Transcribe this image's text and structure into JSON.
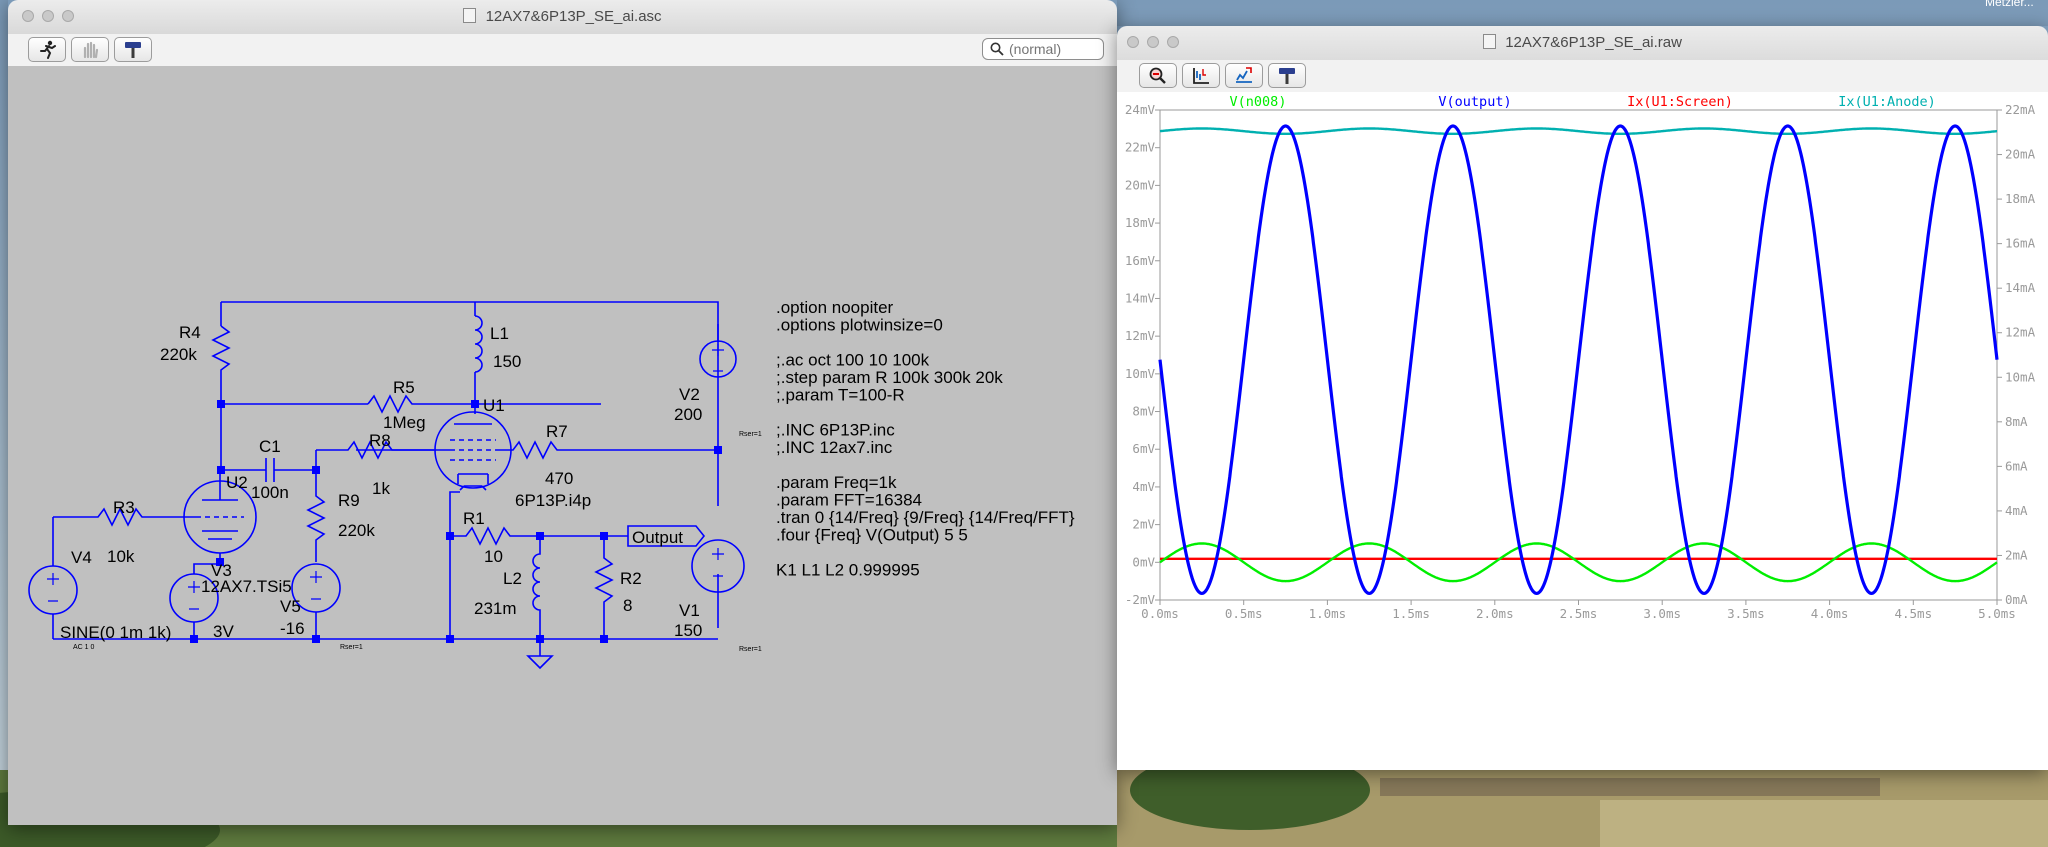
{
  "schematic_window": {
    "title": "12AX7&6P13P_SE_ai.asc",
    "search_placeholder": "(normal)",
    "toolbar": [
      {
        "name": "run-icon"
      },
      {
        "name": "halt-icon"
      },
      {
        "name": "hammer-icon"
      }
    ],
    "components": {
      "R4": {
        "ref": "R4",
        "value": "220k"
      },
      "L1": {
        "ref": "L1",
        "value": "150"
      },
      "R5": {
        "ref": "R5",
        "value": "1Meg"
      },
      "U1": {
        "ref": "U1",
        "model": "6P13P.i4p"
      },
      "C1": {
        "ref": "C1",
        "value": "100n"
      },
      "R8": {
        "ref": "R8",
        "value": "1k"
      },
      "R7": {
        "ref": "R7",
        "value": "470"
      },
      "U2": {
        "ref": "U2",
        "model": "12AX7.TSi5"
      },
      "R3": {
        "ref": "R3",
        "value": "10k"
      },
      "R9": {
        "ref": "R9",
        "value": "220k"
      },
      "R1": {
        "ref": "R1",
        "value": "10"
      },
      "L2": {
        "ref": "L2",
        "value": "231m"
      },
      "R2": {
        "ref": "R2",
        "value": "8"
      },
      "V2": {
        "ref": "V2",
        "value": "200"
      },
      "V1": {
        "ref": "V1",
        "value": "150"
      },
      "V3": {
        "ref": "V3",
        "value": "3V"
      },
      "V4": {
        "ref": "V4",
        "value": "SINE(0 1m 1k)",
        "ac": "AC 1 0"
      },
      "V5": {
        "ref": "V5",
        "value": "-16"
      }
    },
    "rser_labels": [
      "Rser=1",
      "Rser=1",
      "Rser=1"
    ],
    "net_label": "Output",
    "directives": [
      ".option noopiter",
      ".options plotwinsize=0",
      "",
      ";.ac oct 100 10 100k",
      ";.step param R 100k 300k 20k",
      ";.param T=100-R",
      "",
      ";.INC 6P13P.inc",
      ";.INC 12ax7.inc",
      "",
      ".param Freq=1k",
      ".param FFT=16384",
      ".tran 0 {14/Freq} {9/Freq} {14/Freq/FFT}",
      ".four {Freq} V(Output) 5 5",
      "",
      "K1 L1 L2 0.999995"
    ]
  },
  "plot_window": {
    "title": "12AX7&6P13P_SE_ai.raw",
    "toolbar": [
      {
        "name": "zoom-icon"
      },
      {
        "name": "autorange-icon"
      },
      {
        "name": "export-icon"
      },
      {
        "name": "hammer-icon"
      }
    ]
  },
  "desktop": {
    "corner_text": "Metzler..."
  },
  "chart_data": {
    "type": "line",
    "xlabel": "",
    "xlim": [
      0,
      5
    ],
    "x_unit": "ms",
    "x_ticks": [
      "0.0ms",
      "0.5ms",
      "1.0ms",
      "1.5ms",
      "2.0ms",
      "2.5ms",
      "3.0ms",
      "3.5ms",
      "4.0ms",
      "4.5ms",
      "5.0ms"
    ],
    "ylim_left": [
      -2,
      24
    ],
    "y_ticks_left": [
      "-2mV",
      "0mV",
      "2mV",
      "4mV",
      "6mV",
      "8mV",
      "10mV",
      "12mV",
      "14mV",
      "16mV",
      "18mV",
      "20mV",
      "22mV",
      "24mV"
    ],
    "ylim_right": [
      0,
      22
    ],
    "y_ticks_right": [
      "0mA",
      "2mA",
      "4mA",
      "6mA",
      "8mA",
      "10mA",
      "12mA",
      "14mA",
      "16mA",
      "18mA",
      "20mA",
      "22mA"
    ],
    "series": [
      {
        "name": "V(n008)",
        "color": "#00ee00",
        "axis": "left",
        "shape": "sine",
        "offset": 0,
        "amplitude": 1.0,
        "freq_khz": 1,
        "peak_at_ms": 0.25
      },
      {
        "name": "V(output)",
        "color": "#0000ff",
        "axis": "left",
        "shape": "sine",
        "offset": 10.75,
        "amplitude": 12.4,
        "freq_khz": 1,
        "peak_at_ms": 0.75
      },
      {
        "name": "Ix(U1:Screen)",
        "color": "#ff0000",
        "axis": "right",
        "shape": "flat",
        "offset": 1.85,
        "amplitude": 0,
        "freq_khz": 1,
        "peak_at_ms": 0
      },
      {
        "name": "Ix(U1:Anode)",
        "color": "#00b0b0",
        "axis": "right",
        "shape": "sine",
        "offset": 21.05,
        "amplitude": 0.12,
        "freq_khz": 1,
        "peak_at_ms": 0.25
      }
    ]
  }
}
